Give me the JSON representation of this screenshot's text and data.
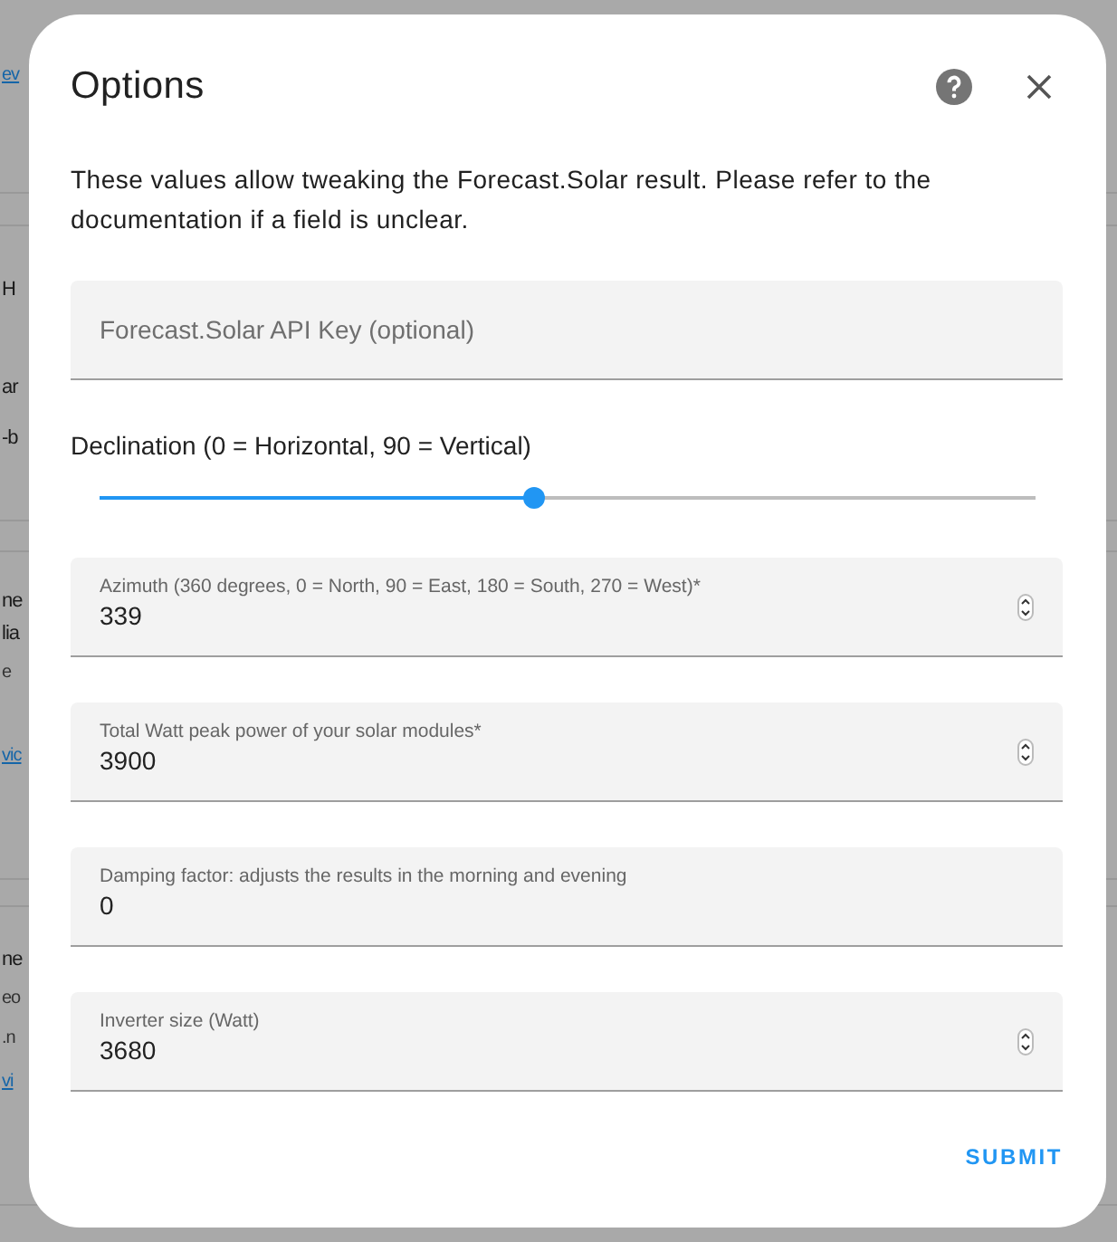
{
  "backdrop": {
    "fragments": [
      {
        "text": "ev",
        "kind": "link"
      },
      {
        "text": "H",
        "kind": "text"
      },
      {
        "text": "ar",
        "kind": "text"
      },
      {
        "text": "-b",
        "kind": "text"
      },
      {
        "text": "ne",
        "kind": "text"
      },
      {
        "text": "lia",
        "kind": "text"
      },
      {
        "text": "e",
        "kind": "small"
      },
      {
        "text": "vic",
        "kind": "link"
      },
      {
        "text": "ne",
        "kind": "text"
      },
      {
        "text": "eo",
        "kind": "small"
      },
      {
        "text": ".n",
        "kind": "small"
      },
      {
        "text": "vi",
        "kind": "link"
      }
    ]
  },
  "dialog": {
    "title": "Options",
    "description": "These values allow tweaking the Forecast.Solar result. Please refer to the documentation if a field is unclear.",
    "fields": [
      {
        "kind": "text",
        "label": "Forecast.Solar API Key (optional)"
      },
      {
        "kind": "slider",
        "label": "Declination (0 = Horizontal, 90 = Vertical)",
        "level": 0.465
      },
      {
        "kind": "number",
        "label": "Azimuth (360 degrees, 0 = North, 90 = East, 180 = South, 270 = West)*",
        "value": "339"
      },
      {
        "kind": "number",
        "label": "Total Watt peak power of your solar modules*",
        "value": "3900"
      },
      {
        "kind": "text",
        "label": "Damping factor: adjusts the results in the morning and evening",
        "value": "0"
      },
      {
        "kind": "number",
        "label": "Inverter size (Watt)",
        "value": "3680"
      }
    ],
    "submit": "SUBMIT"
  }
}
